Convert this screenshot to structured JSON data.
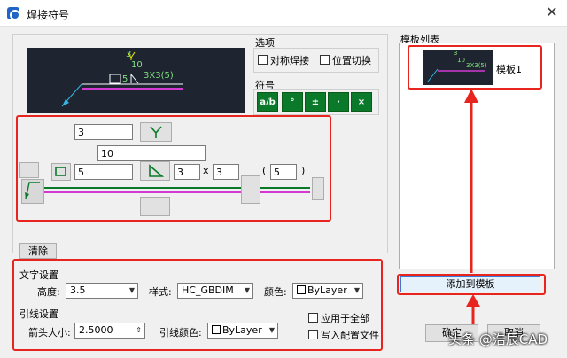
{
  "window": {
    "title": "焊接符号",
    "close_glyph": "✕"
  },
  "preview": {
    "text_top": "3",
    "text_mid": "10",
    "text_left": "5",
    "text_right": "3X3(5)"
  },
  "options": {
    "title": "选项",
    "symmetric": "对称焊接",
    "position_switch": "位置切换"
  },
  "symbols": {
    "title": "符号",
    "buttons": [
      "a/b",
      "°",
      "±",
      "·",
      "×"
    ]
  },
  "editor": {
    "top_value": "3",
    "mid_value": "10",
    "left_value": "5",
    "size_a": "3",
    "times": "x",
    "size_b": "3",
    "paren_open": "(",
    "paren_value": "5",
    "paren_close": ")"
  },
  "clear_button": "清除",
  "text_settings": {
    "title": "文字设置",
    "height_label": "高度:",
    "height_value": "3.5",
    "style_label": "样式:",
    "style_value": "HC_GBDIM",
    "color_label": "颜色:",
    "color_value": "ByLayer"
  },
  "leader_settings": {
    "title": "引线设置",
    "arrow_label": "箭头大小:",
    "arrow_value": "2.5000",
    "leader_color_label": "引线颜色:",
    "leader_color_value": "ByLayer",
    "apply_all": "应用于全部",
    "write_config": "写入配置文件"
  },
  "template_list": {
    "title": "模板列表",
    "items": [
      {
        "label": "模板1",
        "thumb_top": "3",
        "thumb_mid": "10",
        "thumb_right": "3X3(5)"
      }
    ],
    "add_button": "添加到模板"
  },
  "footer": {
    "ok": "确定",
    "cancel": "取消",
    "watermark": "头条 @浩辰CAD"
  },
  "colors": {
    "accent_red": "#e8241e",
    "preview_bg": "#1f2530",
    "weld_green": "#0a7a2a",
    "magenta": "#d23ad2"
  }
}
